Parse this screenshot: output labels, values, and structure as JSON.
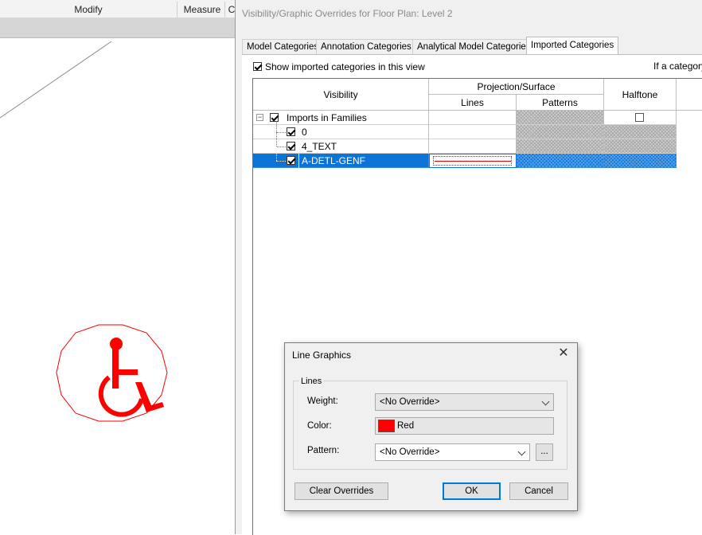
{
  "host": {
    "ribbon_groups": [
      {
        "label": "Modify"
      },
      {
        "label": "Measure"
      },
      {
        "label": "C"
      }
    ]
  },
  "vg_dialog": {
    "title": "Visibility/Graphic Overrides for Floor Plan: Level 2",
    "tabs": [
      {
        "label": "Model Categories",
        "active": false
      },
      {
        "label": "Annotation Categories",
        "active": false
      },
      {
        "label": "Analytical Model Categories",
        "active": false
      },
      {
        "label": "Imported Categories",
        "active": true
      }
    ],
    "show_imported_label": "Show imported categories in this view",
    "show_imported_checked": true,
    "right_note": "If a category",
    "columns": {
      "visibility": "Visibility",
      "projection_surface": "Projection/Surface",
      "lines": "Lines",
      "patterns": "Patterns",
      "halftone": "Halftone"
    },
    "rows": [
      {
        "label": "Imports in Families",
        "level": 0,
        "checked": true,
        "expanded": true,
        "selected": false,
        "halftone_checkbox": true
      },
      {
        "label": "0",
        "level": 1,
        "checked": true,
        "selected": false,
        "halftone_checkbox": false
      },
      {
        "label": "4_TEXT",
        "level": 1,
        "checked": true,
        "selected": false,
        "halftone_checkbox": false
      },
      {
        "label": "A-DETL-GENF",
        "level": 1,
        "checked": true,
        "selected": true,
        "line_override_color": "#e00000"
      }
    ],
    "selection_color": "#0b74d6"
  },
  "line_graphics": {
    "title": "Line Graphics",
    "group_label": "Lines",
    "weight_label": "Weight:",
    "weight_value": "<No Override>",
    "color_label": "Color:",
    "color_value": "Red",
    "color_swatch": "#ff0000",
    "pattern_label": "Pattern:",
    "pattern_value": "<No Override>",
    "pattern_browse_label": "...",
    "clear_overrides_label": "Clear Overrides",
    "ok_label": "OK",
    "cancel_label": "Cancel"
  },
  "canvas": {
    "symbol": "accessibility-symbol",
    "symbol_color": "#ff0000"
  }
}
